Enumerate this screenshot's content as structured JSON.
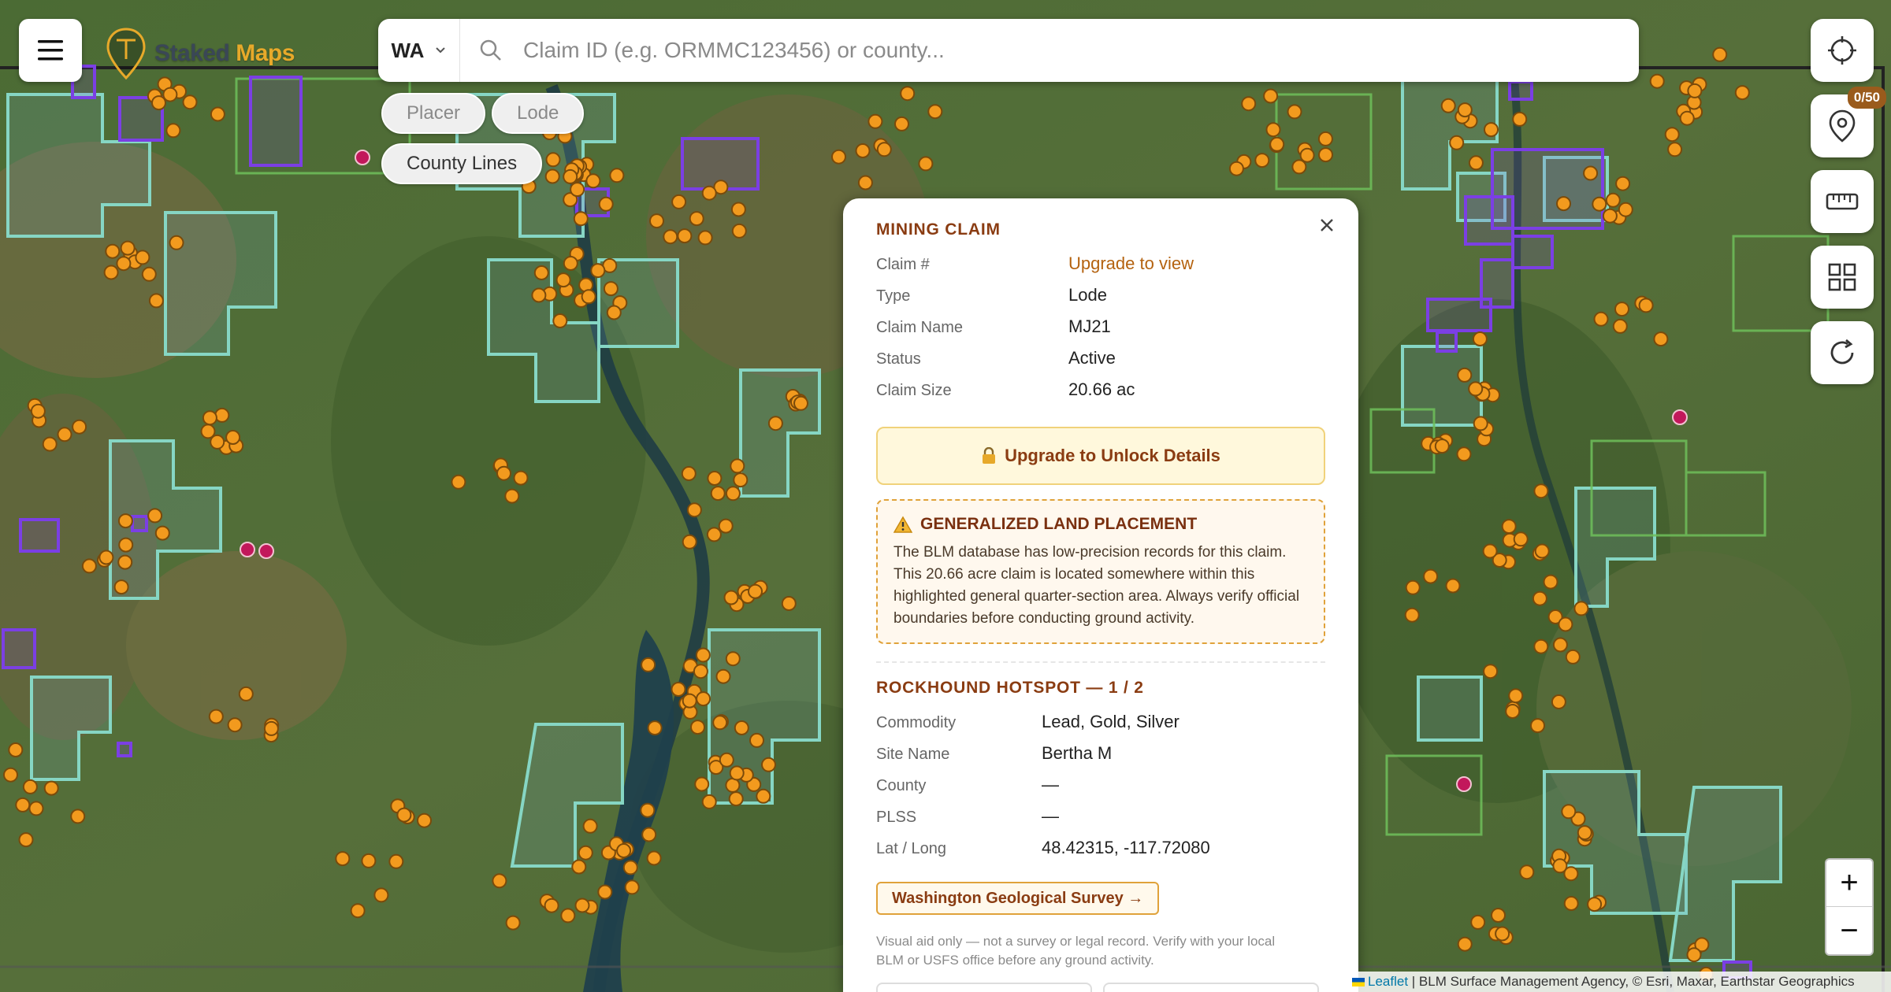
{
  "brand": {
    "part1": "Staked",
    "part2": "Maps"
  },
  "search": {
    "state": "WA",
    "placeholder": "Claim ID (e.g. ORMMC123456) or county..."
  },
  "filters": [
    {
      "label": "Placer",
      "active": false
    },
    {
      "label": "Lode",
      "active": false
    },
    {
      "label": "County Lines",
      "active": true
    }
  ],
  "toolbar": {
    "saved_count": "0/50"
  },
  "popup": {
    "claim_title": "MINING CLAIM",
    "claim_fields": [
      {
        "label": "Claim #",
        "value": "Upgrade to view"
      },
      {
        "label": "Type",
        "value": "Lode"
      },
      {
        "label": "Claim Name",
        "value": "MJ21"
      },
      {
        "label": "Status",
        "value": "Active"
      },
      {
        "label": "Claim Size",
        "value": "20.66 ac"
      }
    ],
    "unlock_label": "Upgrade to Unlock Details",
    "warning_title": "GENERALIZED LAND PLACEMENT",
    "warning_text": "The BLM database has low-precision records for this claim. This 20.66 acre claim is located somewhere within this highlighted general quarter-section area. Always verify official boundaries before conducting ground activity.",
    "hotspot_title": "ROCKHOUND HOTSPOT — 1 / 2",
    "hotspot_fields": [
      {
        "label": "Commodity",
        "value": "Lead, Gold, Silver"
      },
      {
        "label": "Site Name",
        "value": "Bertha M"
      },
      {
        "label": "County",
        "value": "—"
      },
      {
        "label": "PLSS",
        "value": "—"
      },
      {
        "label": "Lat / Long",
        "value": "48.42315, -117.72080"
      }
    ],
    "survey_link": "Washington Geological Survey →",
    "disclaimer": "Visual aid only — not a survey or legal record. Verify with your local BLM or USFS office before any ground activity."
  },
  "zoom": {
    "in": "+",
    "out": "−"
  },
  "attribution": {
    "leaflet": "Leaflet",
    "sources": "| BLM Surface Management Agency, © Esri, Maxar, Earthstar Geographics"
  },
  "colors": {
    "accent": "#e7a92a",
    "claim_outline": "#7b3fe4",
    "land_outline": "#8fd3c0",
    "hotspot_point": "#f29a1e",
    "rare_point": "#c2185b"
  }
}
